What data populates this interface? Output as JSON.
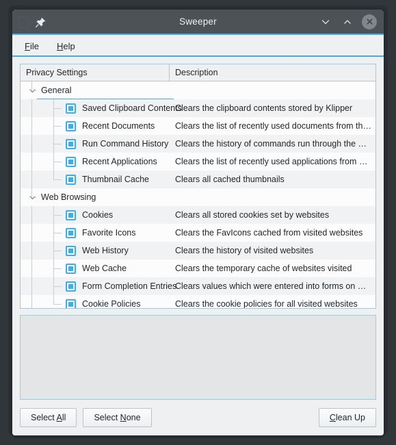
{
  "window": {
    "title": "Sweeper",
    "pin_icon": "pin-icon",
    "ghost_icon": "window-icon-placeholder",
    "controls": [
      {
        "name": "minimize-button",
        "icon": "chevron-down-icon"
      },
      {
        "name": "maximize-button",
        "icon": "chevron-up-icon"
      },
      {
        "name": "close-button",
        "icon": "close-x-icon"
      }
    ]
  },
  "menubar": {
    "items": [
      {
        "name": "menu-file",
        "pre": "",
        "accel": "F",
        "post": "ile"
      },
      {
        "name": "menu-help",
        "pre": "",
        "accel": "H",
        "post": "elp"
      }
    ]
  },
  "tree": {
    "headers": {
      "name": "Privacy Settings",
      "description": "Description"
    },
    "groups": [
      {
        "label": "General",
        "expanded": true,
        "selected": true,
        "items": [
          {
            "label": "Saved Clipboard Contents",
            "description": "Clears the clipboard contents stored by Klipper",
            "checked": true
          },
          {
            "label": "Recent Documents",
            "description": "Clears the list of recently used documents from the …",
            "checked": true
          },
          {
            "label": "Run Command History",
            "description": "Clears the history of commands run through the Run…",
            "checked": true
          },
          {
            "label": "Recent Applications",
            "description": "Clears the list of recently used applications from KD…",
            "checked": true
          },
          {
            "label": "Thumbnail Cache",
            "description": "Clears all cached thumbnails",
            "checked": true
          }
        ]
      },
      {
        "label": "Web Browsing",
        "expanded": true,
        "selected": false,
        "items": [
          {
            "label": "Cookies",
            "description": "Clears all stored cookies set by websites",
            "checked": true
          },
          {
            "label": "Favorite Icons",
            "description": "Clears the FavIcons cached from visited websites",
            "checked": true
          },
          {
            "label": "Web History",
            "description": "Clears the history of visited websites",
            "checked": true
          },
          {
            "label": "Web Cache",
            "description": "Clears the temporary cache of websites visited",
            "checked": true
          },
          {
            "label": "Form Completion Entries",
            "description": "Clears values which were entered into forms on web…",
            "checked": true
          },
          {
            "label": "Cookie Policies",
            "description": "Clears the cookie policies for all visited websites",
            "checked": true
          }
        ]
      }
    ]
  },
  "output_pane": {
    "text": ""
  },
  "buttons": {
    "select_all": {
      "pre": "Select ",
      "accel": "A",
      "post": "ll"
    },
    "select_none": {
      "pre": "Select ",
      "accel": "N",
      "post": "one"
    },
    "clean_up": {
      "pre": "",
      "accel": "C",
      "post": "lean Up"
    }
  },
  "colors": {
    "accent": "#3daee9",
    "titlebar": "#4d5257",
    "window_bg": "#eff0f1",
    "tree_bg": "#fcfcfc",
    "row_alt": "#f1f2f3",
    "output_pane": "#e3e5e7",
    "text": "#232629"
  }
}
